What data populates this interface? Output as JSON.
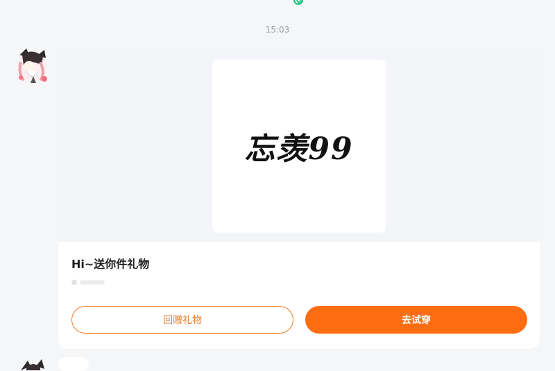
{
  "chat": {
    "timestamp": "15:03"
  },
  "message": {
    "avatar_icon": "anime-character-avatar",
    "gift_image_text": "忘羡99",
    "title": "Hi~送你件礼物",
    "buttons": {
      "return_gift": "回赠礼物",
      "try_on": "去试穿"
    }
  },
  "colors": {
    "accent_orange": "#ff6d12",
    "outline_orange": "#f07b25",
    "status_green": "#19c27a",
    "background": "#f5f6f8"
  }
}
